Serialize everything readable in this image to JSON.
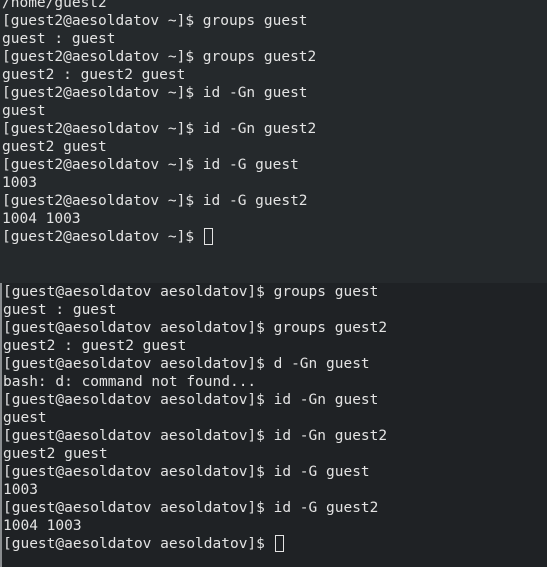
{
  "top_terminal": {
    "lines": [
      "/home/guest2",
      "[guest2@aesoldatov ~]$ groups guest",
      "guest : guest",
      "[guest2@aesoldatov ~]$ groups guest2",
      "guest2 : guest2 guest",
      "[guest2@aesoldatov ~]$ id -Gn guest",
      "guest",
      "[guest2@aesoldatov ~]$ id -Gn guest2",
      "guest2 guest",
      "[guest2@aesoldatov ~]$ id -G guest",
      "1003",
      "[guest2@aesoldatov ~]$ id -G guest2",
      "1004 1003"
    ],
    "prompt": "[guest2@aesoldatov ~]$ "
  },
  "bottom_terminal": {
    "lines": [
      "[guest@aesoldatov aesoldatov]$ groups guest",
      "guest : guest",
      "[guest@aesoldatov aesoldatov]$ groups guest2",
      "guest2 : guest2 guest",
      "[guest@aesoldatov aesoldatov]$ d -Gn guest",
      "bash: d: command not found...",
      "[guest@aesoldatov aesoldatov]$ id -Gn guest",
      "guest",
      "[guest@aesoldatov aesoldatov]$ id -Gn guest2",
      "guest2 guest",
      "[guest@aesoldatov aesoldatov]$ id -G guest",
      "1003",
      "[guest@aesoldatov aesoldatov]$ id -G guest2",
      "1004 1003"
    ],
    "prompt": "[guest@aesoldatov aesoldatov]$ "
  }
}
